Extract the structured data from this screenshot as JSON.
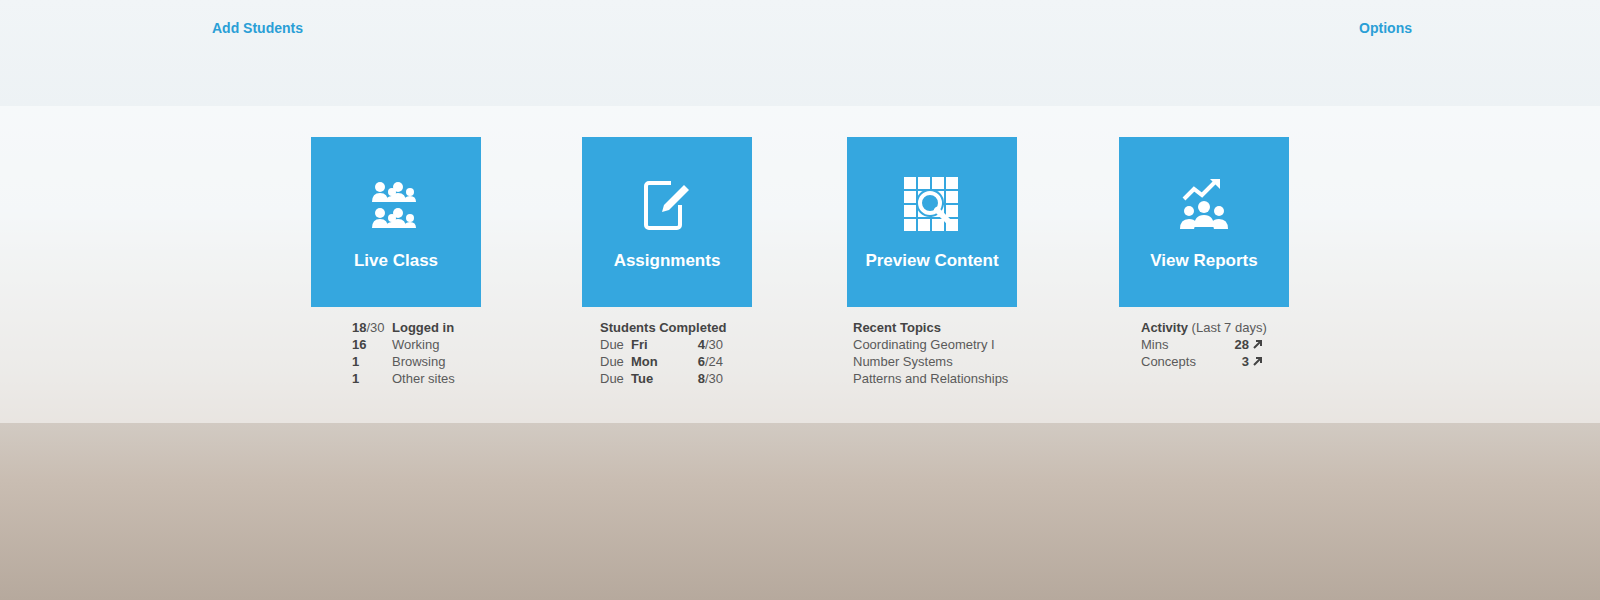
{
  "header": {
    "add_students": "Add Students",
    "options": "Options"
  },
  "tiles": [
    {
      "kind": "live",
      "label": "Live Class",
      "summary": {
        "count": "18",
        "total": "/30",
        "label": "Logged in"
      },
      "rows": [
        {
          "count": "16",
          "label": "Working"
        },
        {
          "count": "1",
          "label": "Browsing"
        },
        {
          "count": "1",
          "label": "Other sites"
        }
      ]
    },
    {
      "kind": "assignments",
      "label": "Assignments",
      "heading": "Students Completed",
      "rows": [
        {
          "prefix": "Due",
          "day": "Fri",
          "done": "4",
          "total": "/30"
        },
        {
          "prefix": "Due",
          "day": "Mon",
          "done": "6",
          "total": "/24"
        },
        {
          "prefix": "Due",
          "day": "Tue",
          "done": "8",
          "total": "/30"
        }
      ]
    },
    {
      "kind": "topics",
      "label": "Preview Content",
      "heading": "Recent Topics",
      "rows": [
        "Coordinating Geometry I",
        "Number Systems",
        "Patterns and Relationships"
      ]
    },
    {
      "kind": "reports",
      "label": "View Reports",
      "heading": "Activity",
      "note": "(Last 7 days)",
      "rows": [
        {
          "label": "Mins",
          "value": "28",
          "trend": "up"
        },
        {
          "label": "Concepts",
          "value": "3",
          "trend": "up"
        }
      ]
    }
  ]
}
